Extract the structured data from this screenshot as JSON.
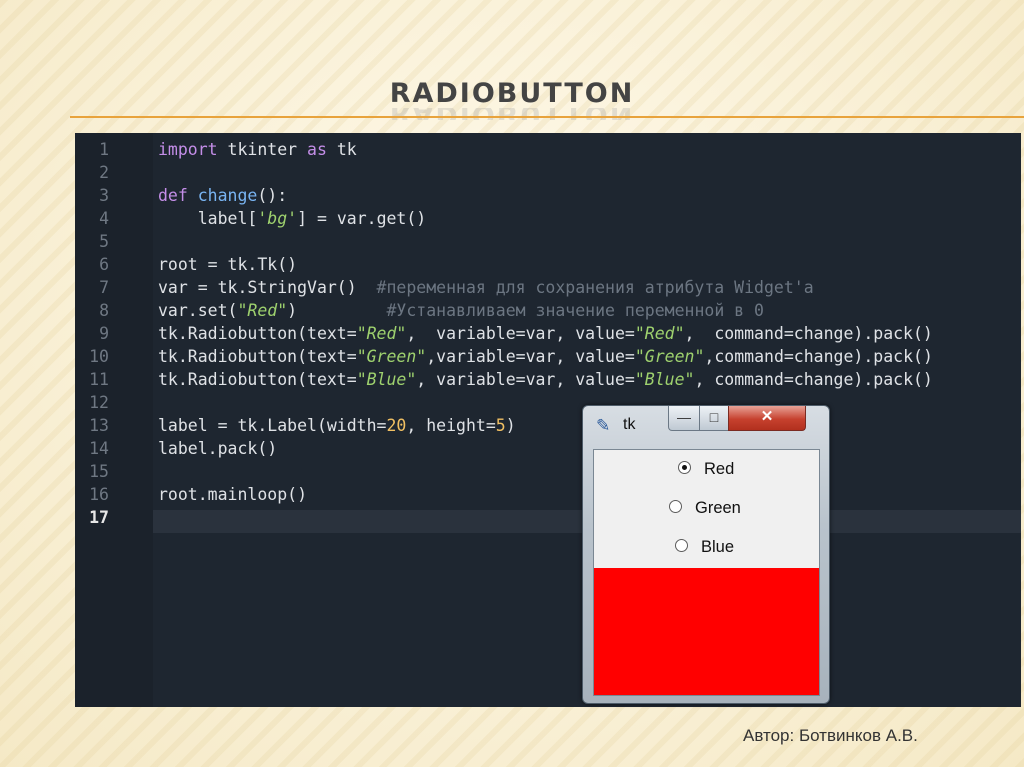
{
  "slide": {
    "title": "RADIOBUTTON",
    "author": "Автор: Ботвинков А.В.",
    "accent_color": "#e8a33c"
  },
  "editor": {
    "background": "#1e2630",
    "active_line": 17,
    "lines": [
      {
        "n": "1",
        "tokens": [
          {
            "t": "import",
            "c": "kw"
          },
          {
            "t": " tkinter ",
            "c": ""
          },
          {
            "t": "as",
            "c": "kw"
          },
          {
            "t": " tk",
            "c": ""
          }
        ]
      },
      {
        "n": "2",
        "tokens": []
      },
      {
        "n": "3",
        "tokens": [
          {
            "t": "def",
            "c": "kw"
          },
          {
            "t": " ",
            "c": ""
          },
          {
            "t": "change",
            "c": "fn"
          },
          {
            "t": "():",
            "c": ""
          }
        ]
      },
      {
        "n": "4",
        "tokens": [
          {
            "t": "    label[",
            "c": ""
          },
          {
            "t": "'bg'",
            "c": "str"
          },
          {
            "t": "] = var.get()",
            "c": ""
          }
        ]
      },
      {
        "n": "5",
        "tokens": []
      },
      {
        "n": "6",
        "tokens": [
          {
            "t": "root = tk.Tk()",
            "c": ""
          }
        ]
      },
      {
        "n": "7",
        "tokens": [
          {
            "t": "var = tk.StringVar()  ",
            "c": ""
          },
          {
            "t": "#переменная для сохранения атрибута Widget'a",
            "c": "cm"
          }
        ]
      },
      {
        "n": "8",
        "tokens": [
          {
            "t": "var.set(",
            "c": ""
          },
          {
            "t": "\"Red\"",
            "c": "str"
          },
          {
            "t": ")         ",
            "c": ""
          },
          {
            "t": "#Устанавливаем значение переменной в 0",
            "c": "cm"
          }
        ]
      },
      {
        "n": "9",
        "tokens": [
          {
            "t": "tk.Radiobutton(text=",
            "c": ""
          },
          {
            "t": "\"Red\"",
            "c": "str"
          },
          {
            "t": ",  variable=var, value=",
            "c": ""
          },
          {
            "t": "\"Red\"",
            "c": "str"
          },
          {
            "t": ",  command=change).pack()",
            "c": ""
          }
        ]
      },
      {
        "n": "10",
        "tokens": [
          {
            "t": "tk.Radiobutton(text=",
            "c": ""
          },
          {
            "t": "\"Green\"",
            "c": "str"
          },
          {
            "t": ",variable=var, value=",
            "c": ""
          },
          {
            "t": "\"Green\"",
            "c": "str"
          },
          {
            "t": ",command=change).pack()",
            "c": ""
          }
        ]
      },
      {
        "n": "11",
        "tokens": [
          {
            "t": "tk.Radiobutton(text=",
            "c": ""
          },
          {
            "t": "\"Blue\"",
            "c": "str"
          },
          {
            "t": ", variable=var, value=",
            "c": ""
          },
          {
            "t": "\"Blue\"",
            "c": "str"
          },
          {
            "t": ", command=change).pack()",
            "c": ""
          }
        ]
      },
      {
        "n": "12",
        "tokens": []
      },
      {
        "n": "13",
        "tokens": [
          {
            "t": "label = tk.Label(width=",
            "c": ""
          },
          {
            "t": "20",
            "c": "num"
          },
          {
            "t": ", height=",
            "c": ""
          },
          {
            "t": "5",
            "c": "num"
          },
          {
            "t": ")",
            "c": ""
          }
        ]
      },
      {
        "n": "14",
        "tokens": [
          {
            "t": "label.pack()",
            "c": ""
          }
        ]
      },
      {
        "n": "15",
        "tokens": []
      },
      {
        "n": "16",
        "tokens": [
          {
            "t": "root.mainloop()",
            "c": ""
          }
        ]
      },
      {
        "n": "17",
        "tokens": []
      }
    ]
  },
  "tk_window": {
    "title": "tk",
    "icon": "feather-icon",
    "minimize_glyph": "—",
    "maximize_glyph": "□",
    "close_glyph": "✕",
    "radio_options": [
      {
        "label": "Red",
        "checked": true
      },
      {
        "label": "Green",
        "checked": false
      },
      {
        "label": "Blue",
        "checked": false
      }
    ],
    "label_color": "#ff0000"
  }
}
